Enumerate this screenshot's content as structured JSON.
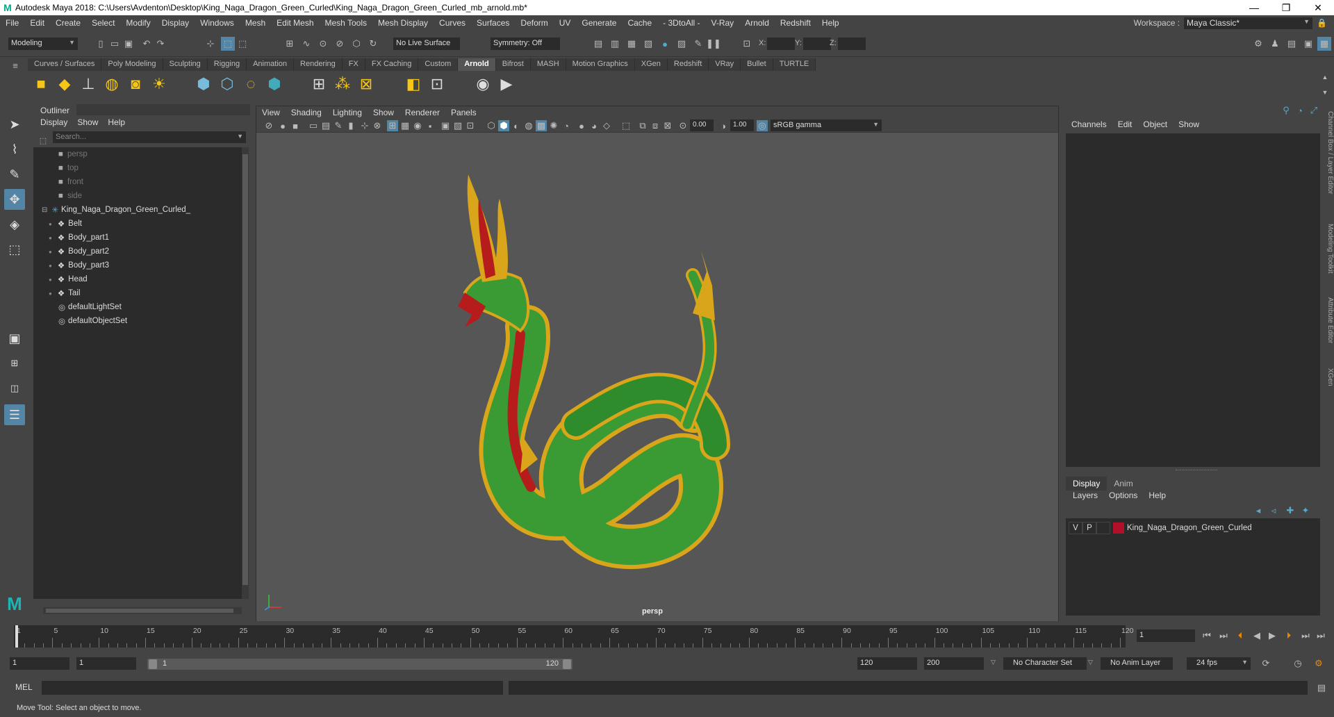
{
  "titlebar": {
    "title": "Autodesk Maya 2018: C:\\Users\\Avdenton\\Desktop\\King_Naga_Dragon_Green_Curled\\King_Naga_Dragon_Green_Curled_mb_arnold.mb*",
    "minimize": "—",
    "maximize": "❐",
    "close": "✕"
  },
  "menubar": {
    "items": [
      "File",
      "Edit",
      "Create",
      "Select",
      "Modify",
      "Display",
      "Windows",
      "Mesh",
      "Edit Mesh",
      "Mesh Tools",
      "Mesh Display",
      "Curves",
      "Surfaces",
      "Deform",
      "UV",
      "Generate",
      "Cache",
      "- 3DtoAll -",
      "V-Ray",
      "Arnold",
      "Redshift",
      "Help"
    ],
    "workspace_label": "Workspace :",
    "workspace_value": "Maya Classic*"
  },
  "statusline": {
    "mode": "Modeling",
    "live_surface": "No Live Surface",
    "symmetry": "Symmetry: Off",
    "x_label": "X:",
    "y_label": "Y:",
    "z_label": "Z:"
  },
  "shelf": {
    "tabs": [
      "Curves / Surfaces",
      "Poly Modeling",
      "Sculpting",
      "Rigging",
      "Animation",
      "Rendering",
      "FX",
      "FX Caching",
      "Custom",
      "Arnold",
      "Bifrost",
      "MASH",
      "Motion Graphics",
      "XGen",
      "Redshift",
      "VRay",
      "Bullet",
      "TURTLE"
    ],
    "active_tab": "Arnold"
  },
  "outliner": {
    "title": "Outliner",
    "menu": [
      "Display",
      "Show",
      "Help"
    ],
    "search_placeholder": "Search...",
    "cameras": [
      "persp",
      "top",
      "front",
      "side"
    ],
    "root": "King_Naga_Dragon_Green_Curled_",
    "children": [
      "Belt",
      "Body_part1",
      "Body_part2",
      "Body_part3",
      "Head",
      "Tail"
    ],
    "sets": [
      "defaultLightSet",
      "defaultObjectSet"
    ]
  },
  "viewport": {
    "menu": [
      "View",
      "Shading",
      "Lighting",
      "Show",
      "Renderer",
      "Panels"
    ],
    "exposure": "0.00",
    "gamma": "1.00",
    "color_space": "sRGB gamma",
    "camera_label": "persp"
  },
  "channelbox": {
    "menu": [
      "Channels",
      "Edit",
      "Object",
      "Show"
    ],
    "layer_tabs": [
      "Display",
      "Anim"
    ],
    "layer_menu": [
      "Layers",
      "Options",
      "Help"
    ],
    "layer": {
      "v": "V",
      "p": "P",
      "name": "King_Naga_Dragon_Green_Curled",
      "color": "#b0102a"
    }
  },
  "side_tabs": [
    "Channel Box / Layer Editor",
    "Modeling Toolkit",
    "Attribute Editor",
    "XGen"
  ],
  "timeslider": {
    "ticks": [
      "1",
      "5",
      "10",
      "15",
      "20",
      "25",
      "30",
      "35",
      "40",
      "45",
      "50",
      "55",
      "60",
      "65",
      "70",
      "75",
      "80",
      "85",
      "90",
      "95",
      "100",
      "105",
      "110",
      "115",
      "120"
    ],
    "current_frame": "1"
  },
  "rangeslider": {
    "start": "1",
    "playback_start": "1",
    "range_start": "1",
    "range_end": "120",
    "playback_end": "120",
    "end": "200",
    "character_set": "No Character Set",
    "anim_layer": "No Anim Layer",
    "fps": "24 fps"
  },
  "cmdline": {
    "label": "MEL"
  },
  "helpline": {
    "text": "Move Tool: Select an object to move."
  }
}
